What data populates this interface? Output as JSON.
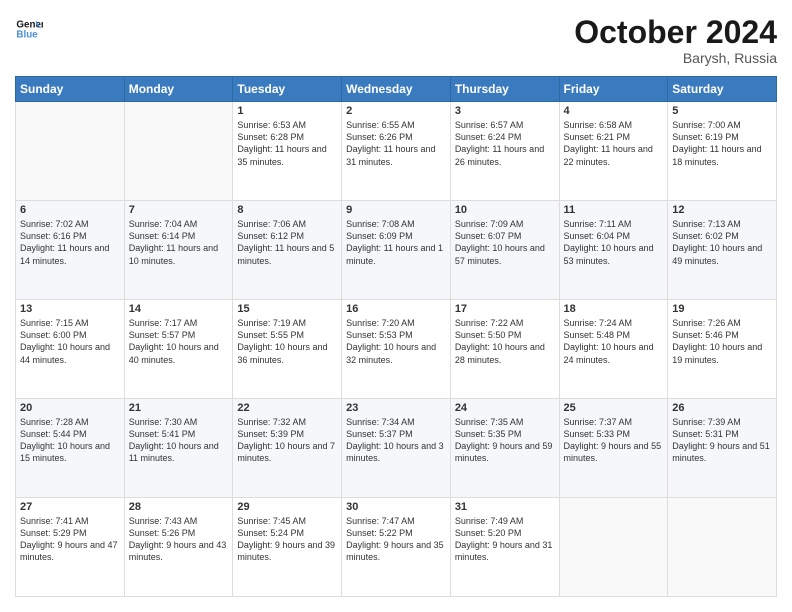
{
  "logo": {
    "line1": "General",
    "line2": "Blue"
  },
  "header": {
    "month": "October 2024",
    "location": "Barysh, Russia"
  },
  "weekdays": [
    "Sunday",
    "Monday",
    "Tuesday",
    "Wednesday",
    "Thursday",
    "Friday",
    "Saturday"
  ],
  "weeks": [
    [
      {
        "day": "",
        "sunrise": "",
        "sunset": "",
        "daylight": ""
      },
      {
        "day": "",
        "sunrise": "",
        "sunset": "",
        "daylight": ""
      },
      {
        "day": "1",
        "sunrise": "Sunrise: 6:53 AM",
        "sunset": "Sunset: 6:28 PM",
        "daylight": "Daylight: 11 hours and 35 minutes."
      },
      {
        "day": "2",
        "sunrise": "Sunrise: 6:55 AM",
        "sunset": "Sunset: 6:26 PM",
        "daylight": "Daylight: 11 hours and 31 minutes."
      },
      {
        "day": "3",
        "sunrise": "Sunrise: 6:57 AM",
        "sunset": "Sunset: 6:24 PM",
        "daylight": "Daylight: 11 hours and 26 minutes."
      },
      {
        "day": "4",
        "sunrise": "Sunrise: 6:58 AM",
        "sunset": "Sunset: 6:21 PM",
        "daylight": "Daylight: 11 hours and 22 minutes."
      },
      {
        "day": "5",
        "sunrise": "Sunrise: 7:00 AM",
        "sunset": "Sunset: 6:19 PM",
        "daylight": "Daylight: 11 hours and 18 minutes."
      }
    ],
    [
      {
        "day": "6",
        "sunrise": "Sunrise: 7:02 AM",
        "sunset": "Sunset: 6:16 PM",
        "daylight": "Daylight: 11 hours and 14 minutes."
      },
      {
        "day": "7",
        "sunrise": "Sunrise: 7:04 AM",
        "sunset": "Sunset: 6:14 PM",
        "daylight": "Daylight: 11 hours and 10 minutes."
      },
      {
        "day": "8",
        "sunrise": "Sunrise: 7:06 AM",
        "sunset": "Sunset: 6:12 PM",
        "daylight": "Daylight: 11 hours and 5 minutes."
      },
      {
        "day": "9",
        "sunrise": "Sunrise: 7:08 AM",
        "sunset": "Sunset: 6:09 PM",
        "daylight": "Daylight: 11 hours and 1 minute."
      },
      {
        "day": "10",
        "sunrise": "Sunrise: 7:09 AM",
        "sunset": "Sunset: 6:07 PM",
        "daylight": "Daylight: 10 hours and 57 minutes."
      },
      {
        "day": "11",
        "sunrise": "Sunrise: 7:11 AM",
        "sunset": "Sunset: 6:04 PM",
        "daylight": "Daylight: 10 hours and 53 minutes."
      },
      {
        "day": "12",
        "sunrise": "Sunrise: 7:13 AM",
        "sunset": "Sunset: 6:02 PM",
        "daylight": "Daylight: 10 hours and 49 minutes."
      }
    ],
    [
      {
        "day": "13",
        "sunrise": "Sunrise: 7:15 AM",
        "sunset": "Sunset: 6:00 PM",
        "daylight": "Daylight: 10 hours and 44 minutes."
      },
      {
        "day": "14",
        "sunrise": "Sunrise: 7:17 AM",
        "sunset": "Sunset: 5:57 PM",
        "daylight": "Daylight: 10 hours and 40 minutes."
      },
      {
        "day": "15",
        "sunrise": "Sunrise: 7:19 AM",
        "sunset": "Sunset: 5:55 PM",
        "daylight": "Daylight: 10 hours and 36 minutes."
      },
      {
        "day": "16",
        "sunrise": "Sunrise: 7:20 AM",
        "sunset": "Sunset: 5:53 PM",
        "daylight": "Daylight: 10 hours and 32 minutes."
      },
      {
        "day": "17",
        "sunrise": "Sunrise: 7:22 AM",
        "sunset": "Sunset: 5:50 PM",
        "daylight": "Daylight: 10 hours and 28 minutes."
      },
      {
        "day": "18",
        "sunrise": "Sunrise: 7:24 AM",
        "sunset": "Sunset: 5:48 PM",
        "daylight": "Daylight: 10 hours and 24 minutes."
      },
      {
        "day": "19",
        "sunrise": "Sunrise: 7:26 AM",
        "sunset": "Sunset: 5:46 PM",
        "daylight": "Daylight: 10 hours and 19 minutes."
      }
    ],
    [
      {
        "day": "20",
        "sunrise": "Sunrise: 7:28 AM",
        "sunset": "Sunset: 5:44 PM",
        "daylight": "Daylight: 10 hours and 15 minutes."
      },
      {
        "day": "21",
        "sunrise": "Sunrise: 7:30 AM",
        "sunset": "Sunset: 5:41 PM",
        "daylight": "Daylight: 10 hours and 11 minutes."
      },
      {
        "day": "22",
        "sunrise": "Sunrise: 7:32 AM",
        "sunset": "Sunset: 5:39 PM",
        "daylight": "Daylight: 10 hours and 7 minutes."
      },
      {
        "day": "23",
        "sunrise": "Sunrise: 7:34 AM",
        "sunset": "Sunset: 5:37 PM",
        "daylight": "Daylight: 10 hours and 3 minutes."
      },
      {
        "day": "24",
        "sunrise": "Sunrise: 7:35 AM",
        "sunset": "Sunset: 5:35 PM",
        "daylight": "Daylight: 9 hours and 59 minutes."
      },
      {
        "day": "25",
        "sunrise": "Sunrise: 7:37 AM",
        "sunset": "Sunset: 5:33 PM",
        "daylight": "Daylight: 9 hours and 55 minutes."
      },
      {
        "day": "26",
        "sunrise": "Sunrise: 7:39 AM",
        "sunset": "Sunset: 5:31 PM",
        "daylight": "Daylight: 9 hours and 51 minutes."
      }
    ],
    [
      {
        "day": "27",
        "sunrise": "Sunrise: 7:41 AM",
        "sunset": "Sunset: 5:29 PM",
        "daylight": "Daylight: 9 hours and 47 minutes."
      },
      {
        "day": "28",
        "sunrise": "Sunrise: 7:43 AM",
        "sunset": "Sunset: 5:26 PM",
        "daylight": "Daylight: 9 hours and 43 minutes."
      },
      {
        "day": "29",
        "sunrise": "Sunrise: 7:45 AM",
        "sunset": "Sunset: 5:24 PM",
        "daylight": "Daylight: 9 hours and 39 minutes."
      },
      {
        "day": "30",
        "sunrise": "Sunrise: 7:47 AM",
        "sunset": "Sunset: 5:22 PM",
        "daylight": "Daylight: 9 hours and 35 minutes."
      },
      {
        "day": "31",
        "sunrise": "Sunrise: 7:49 AM",
        "sunset": "Sunset: 5:20 PM",
        "daylight": "Daylight: 9 hours and 31 minutes."
      },
      {
        "day": "",
        "sunrise": "",
        "sunset": "",
        "daylight": ""
      },
      {
        "day": "",
        "sunrise": "",
        "sunset": "",
        "daylight": ""
      }
    ]
  ]
}
